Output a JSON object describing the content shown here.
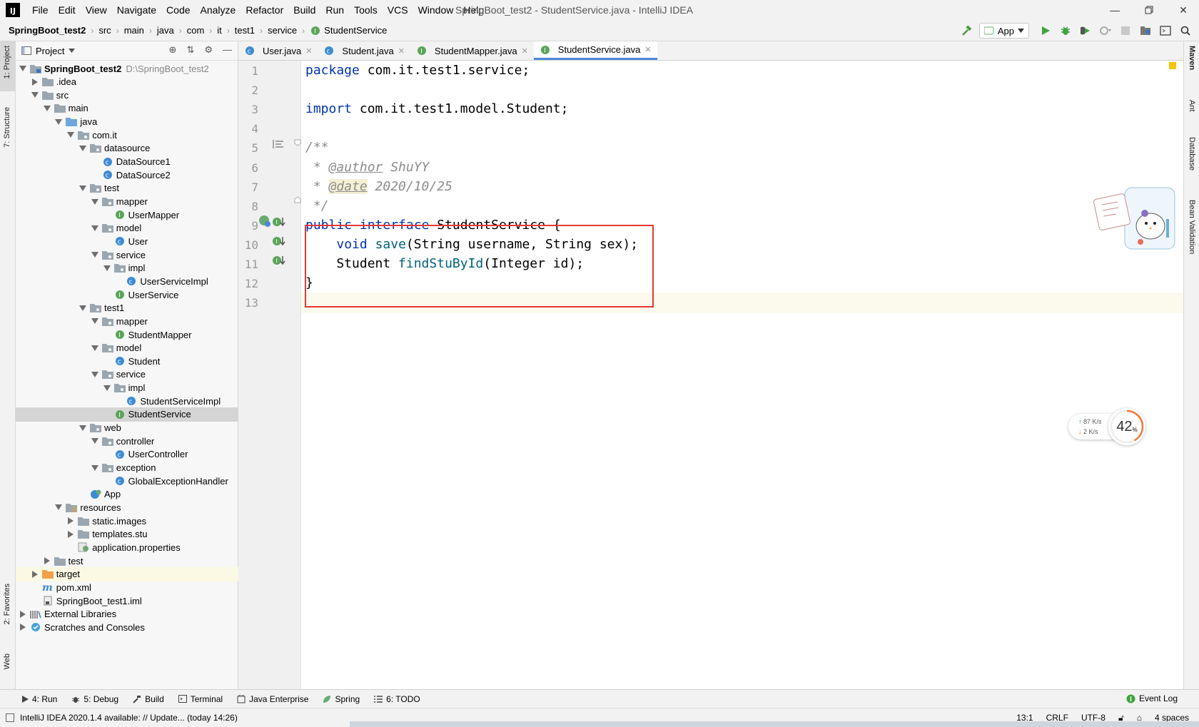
{
  "window": {
    "title": "SpringBoot_test2 - StudentService.java - IntelliJ IDEA",
    "logo_text": "IJ"
  },
  "menu": [
    "File",
    "Edit",
    "View",
    "Navigate",
    "Code",
    "Analyze",
    "Refactor",
    "Build",
    "Run",
    "Tools",
    "VCS",
    "Window",
    "Help"
  ],
  "breadcrumb": [
    "SpringBoot_test2",
    "src",
    "main",
    "java",
    "com",
    "it",
    "test1",
    "service",
    "StudentService"
  ],
  "run_config": "App",
  "left_tool_windows": [
    "1: Project",
    "7: Structure",
    "2: Favorites",
    "Web"
  ],
  "right_tool_windows": [
    "Maven",
    "Ant",
    "Database",
    "Bean Validation"
  ],
  "project_panel": {
    "title": "Project",
    "tree": [
      {
        "label": "SpringBoot_test2",
        "extra": "D:\\SpringBoot_test2",
        "depth": 0,
        "icon": "module",
        "expanded": true,
        "bold": true
      },
      {
        "label": ".idea",
        "depth": 1,
        "icon": "folder",
        "expanded": false
      },
      {
        "label": "src",
        "depth": 1,
        "icon": "folder",
        "expanded": true
      },
      {
        "label": "main",
        "depth": 2,
        "icon": "folder",
        "expanded": true
      },
      {
        "label": "java",
        "depth": 3,
        "icon": "folder-blue",
        "expanded": true
      },
      {
        "label": "com.it",
        "depth": 4,
        "icon": "package",
        "expanded": true
      },
      {
        "label": "datasource",
        "depth": 5,
        "icon": "package",
        "expanded": true
      },
      {
        "label": "DataSource1",
        "depth": 6,
        "icon": "class"
      },
      {
        "label": "DataSource2",
        "depth": 6,
        "icon": "class"
      },
      {
        "label": "test",
        "depth": 5,
        "icon": "package",
        "expanded": true
      },
      {
        "label": "mapper",
        "depth": 6,
        "icon": "package",
        "expanded": true
      },
      {
        "label": "UserMapper",
        "depth": 7,
        "icon": "interface"
      },
      {
        "label": "model",
        "depth": 6,
        "icon": "package",
        "expanded": true
      },
      {
        "label": "User",
        "depth": 7,
        "icon": "class"
      },
      {
        "label": "service",
        "depth": 6,
        "icon": "package",
        "expanded": true
      },
      {
        "label": "impl",
        "depth": 7,
        "icon": "package",
        "expanded": true
      },
      {
        "label": "UserServiceImpl",
        "depth": 8,
        "icon": "class"
      },
      {
        "label": "UserService",
        "depth": 7,
        "icon": "interface"
      },
      {
        "label": "test1",
        "depth": 5,
        "icon": "package",
        "expanded": true
      },
      {
        "label": "mapper",
        "depth": 6,
        "icon": "package",
        "expanded": true
      },
      {
        "label": "StudentMapper",
        "depth": 7,
        "icon": "interface"
      },
      {
        "label": "model",
        "depth": 6,
        "icon": "package",
        "expanded": true
      },
      {
        "label": "Student",
        "depth": 7,
        "icon": "class"
      },
      {
        "label": "service",
        "depth": 6,
        "icon": "package",
        "expanded": true
      },
      {
        "label": "impl",
        "depth": 7,
        "icon": "package",
        "expanded": true
      },
      {
        "label": "StudentServiceImpl",
        "depth": 8,
        "icon": "class"
      },
      {
        "label": "StudentService",
        "depth": 7,
        "icon": "interface",
        "selected": true
      },
      {
        "label": "web",
        "depth": 5,
        "icon": "package",
        "expanded": true
      },
      {
        "label": "controller",
        "depth": 6,
        "icon": "package",
        "expanded": true
      },
      {
        "label": "UserController",
        "depth": 7,
        "icon": "class"
      },
      {
        "label": "exception",
        "depth": 6,
        "icon": "package",
        "expanded": true
      },
      {
        "label": "GlobalExceptionHandler",
        "depth": 7,
        "icon": "class"
      },
      {
        "label": "App",
        "depth": 5,
        "icon": "spring-class"
      },
      {
        "label": "resources",
        "depth": 3,
        "icon": "resources",
        "expanded": true
      },
      {
        "label": "static.images",
        "depth": 4,
        "icon": "folder",
        "expanded": false
      },
      {
        "label": "templates.stu",
        "depth": 4,
        "icon": "folder",
        "expanded": false
      },
      {
        "label": "application.properties",
        "depth": 4,
        "icon": "properties"
      },
      {
        "label": "test",
        "depth": 2,
        "icon": "folder",
        "expanded": false
      },
      {
        "label": "target",
        "depth": 1,
        "icon": "folder-orange",
        "expanded": false,
        "highlight": true
      },
      {
        "label": "pom.xml",
        "depth": 1,
        "icon": "maven"
      },
      {
        "label": "SpringBoot_test1.iml",
        "depth": 1,
        "icon": "iml"
      },
      {
        "label": "External Libraries",
        "depth": 0,
        "icon": "libraries",
        "expanded": false
      },
      {
        "label": "Scratches and Consoles",
        "depth": 0,
        "icon": "scratches",
        "expanded": false
      }
    ]
  },
  "editor_tabs": [
    {
      "label": "User.java",
      "icon": "class"
    },
    {
      "label": "Student.java",
      "icon": "class"
    },
    {
      "label": "StudentMapper.java",
      "icon": "interface"
    },
    {
      "label": "StudentService.java",
      "icon": "interface",
      "active": true
    }
  ],
  "code": {
    "line_numbers": [
      "1",
      "2",
      "3",
      "4",
      "5",
      "6",
      "7",
      "8",
      "9",
      "10",
      "11",
      "12",
      "13"
    ],
    "lines": [
      [
        {
          "t": "package",
          "c": "kw"
        },
        {
          "t": " com.it.test1.service;"
        }
      ],
      [],
      [
        {
          "t": "import",
          "c": "kw"
        },
        {
          "t": " com.it.test1.model.Student;"
        }
      ],
      [],
      [
        {
          "t": "/**",
          "c": "cm"
        }
      ],
      [
        {
          "t": " * ",
          "c": "cm"
        },
        {
          "t": "@author",
          "c": "tag"
        },
        {
          "t": " ShuYY",
          "c": "cm"
        }
      ],
      [
        {
          "t": " * ",
          "c": "cm"
        },
        {
          "t": "@date",
          "c": "tag tag-hl"
        },
        {
          "t": " 2020/10/25",
          "c": "cm"
        }
      ],
      [
        {
          "t": " */",
          "c": "cm"
        }
      ],
      [
        {
          "t": "public",
          "c": "kw"
        },
        {
          "t": " "
        },
        {
          "t": "interface",
          "c": "kw"
        },
        {
          "t": " StudentService {"
        }
      ],
      [
        {
          "t": "    "
        },
        {
          "t": "void",
          "c": "kw"
        },
        {
          "t": " "
        },
        {
          "t": "save",
          "c": "fn"
        },
        {
          "t": "(String username, String sex);"
        }
      ],
      [
        {
          "t": "    Student "
        },
        {
          "t": "findStuById",
          "c": "fn"
        },
        {
          "t": "(Integer id);"
        }
      ],
      [
        {
          "t": "}"
        }
      ],
      []
    ]
  },
  "network_widget": {
    "up": "87  K/s",
    "down": "2   K/s",
    "percent": "42",
    "percent_unit": "%"
  },
  "bottom_tools": [
    {
      "label": "4: Run",
      "icon": "run-icon"
    },
    {
      "label": "5: Debug",
      "icon": "debug-icon"
    },
    {
      "label": "Build",
      "icon": "build-icon"
    },
    {
      "label": "Terminal",
      "icon": "terminal-icon"
    },
    {
      "label": "Java Enterprise",
      "icon": "java-enterprise-icon"
    },
    {
      "label": "Spring",
      "icon": "spring-icon"
    },
    {
      "label": "6: TODO",
      "icon": "todo-icon"
    }
  ],
  "event_log": "Event Log",
  "status": {
    "message": "IntelliJ IDEA 2020.1.4 available: // Update... (today 14:26)",
    "position": "13:1",
    "line_sep": "CRLF",
    "encoding": "UTF-8",
    "indent": "4 spaces"
  },
  "colors": {
    "keyword": "#0033b3",
    "comment": "#8c8c8c",
    "method": "#00627a",
    "selection_box": "#e53935",
    "tab_underline": "#4a87d8"
  }
}
